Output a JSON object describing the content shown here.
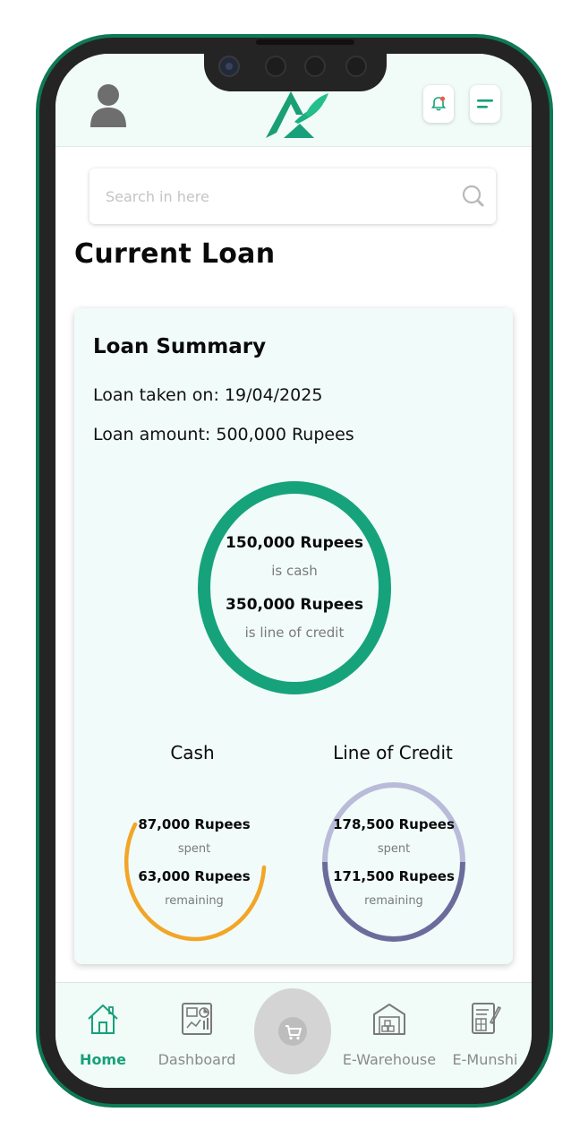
{
  "header": {
    "avatar_icon": "user-avatar-icon",
    "logo_icon": "brand-logo-icon",
    "notification_icon": "bell-icon",
    "menu_icon": "menu-icon"
  },
  "search": {
    "placeholder": "Search in here",
    "value": "",
    "icon": "search-icon"
  },
  "page": {
    "title": "Current Loan"
  },
  "loan_summary": {
    "title": "Loan Summary",
    "taken_on": "Loan taken on: 19/04/2025",
    "amount": "Loan amount: 500,000 Rupees",
    "ring": {
      "cash_value": "150,000 Rupees",
      "cash_label": "is cash",
      "credit_value": "350,000 Rupees",
      "credit_label": "is line of credit"
    },
    "cash": {
      "title": "Cash",
      "spent_value": "87,000 Rupees",
      "spent_label": "spent",
      "remaining_value": "63,000 Rupees",
      "remaining_label": "remaining"
    },
    "credit": {
      "title": "Line of Credit",
      "spent_value": "178,500 Rupees",
      "spent_label": "spent",
      "remaining_value": "171,500 Rupees",
      "remaining_label": "remaining"
    }
  },
  "colors": {
    "brand_green": "#17a07a",
    "ring_green": "#16a37b",
    "cash_orange": "#f2a527",
    "credit_light": "#b9bbd9",
    "credit_dark": "#6b6c9c",
    "card_bg": "#f1fbf9"
  },
  "nav": {
    "items": [
      {
        "label": "Home",
        "icon": "home-icon",
        "active": true
      },
      {
        "label": "Dashboard",
        "icon": "dashboard-icon",
        "active": false
      },
      {
        "label": "",
        "icon": "cart-icon",
        "active": false
      },
      {
        "label": "E-Warehouse",
        "icon": "warehouse-icon",
        "active": false
      },
      {
        "label": "E-Munshi",
        "icon": "ledger-icon",
        "active": false
      }
    ]
  }
}
